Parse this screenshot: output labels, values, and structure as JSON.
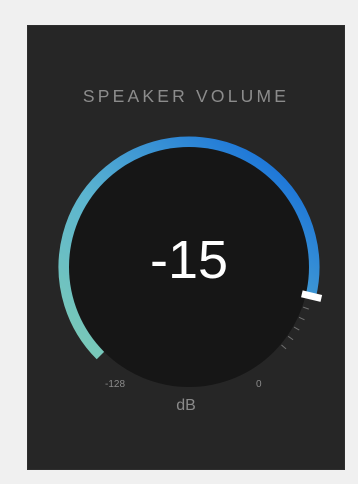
{
  "panel": {
    "title": "SPEAKER VOLUME"
  },
  "knob": {
    "value_text": "-15",
    "min_label": "-128",
    "max_label": "0",
    "unit": "dB",
    "min": -128,
    "max": 0,
    "value": -15,
    "colors": {
      "panel_bg": "#262626",
      "knob_bg": "#161616",
      "arc_start": "#7fcdb4",
      "arc_end": "#1f78d8",
      "tick": "#707070",
      "indicator": "#ffffff"
    }
  }
}
